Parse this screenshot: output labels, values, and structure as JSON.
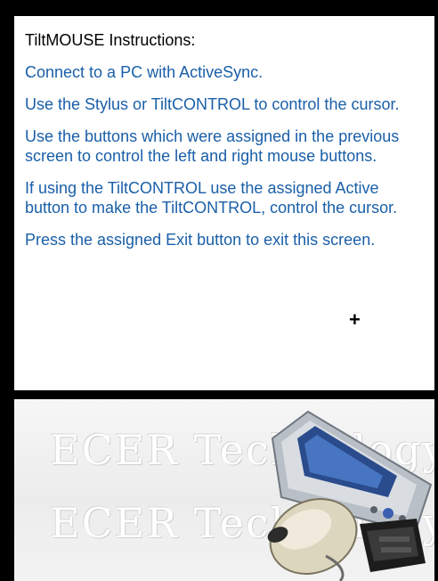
{
  "instructions": {
    "title": "TiltMOUSE Instructions:",
    "items": [
      "Connect to a PC with ActiveSync.",
      "Use the Stylus or TiltCONTROL to control the cursor.",
      "Use the buttons which were assigned in the previous screen to control the left and right mouse buttons.",
      "If using the TiltCONTROL use the assigned Active button to make the TiltCONTROL, control the cursor.",
      "Press the assigned Exit button to exit this screen."
    ],
    "cursor_glyph": "+"
  },
  "graphic": {
    "watermark_line_1": "ECER Technology",
    "watermark_line_2": "ECER Technology",
    "device_icon": "pda-device-icon",
    "mouse_icon": "computer-mouse-icon",
    "adapter_icon": "usb-adapter-icon"
  },
  "colors": {
    "instruction_text": "#1a5fa8",
    "title_text": "#000000",
    "frame": "#000000"
  }
}
